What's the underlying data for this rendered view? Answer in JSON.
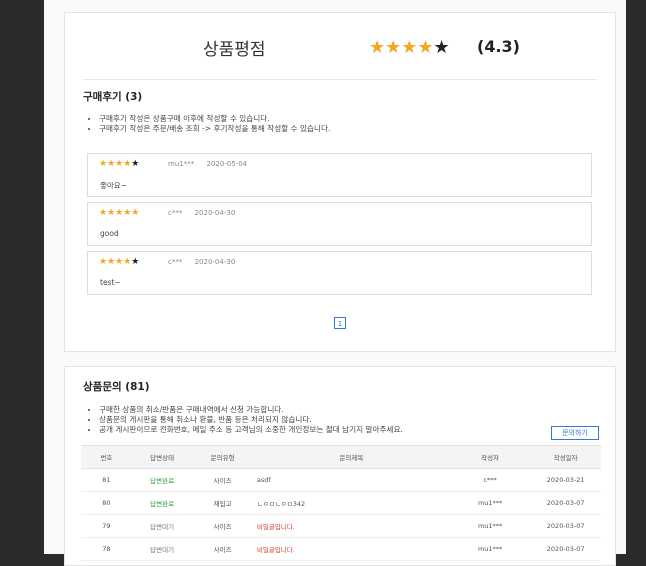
{
  "rating": {
    "title": "상품평점",
    "score_text": "(4.3)",
    "stars": "★★★★★"
  },
  "reviews_section": {
    "title": "구매후기",
    "count": "(3)",
    "notices": [
      "구매후기 작성은 상품구매 이후에 작성할 수 있습니다.",
      "구매후기 작성은 주문/배송 조회 -> 후기작성을 통해 작성할 수 있습니다."
    ],
    "items": [
      {
        "stars_on": "★★★★",
        "stars_off": "★",
        "user": "mu1***",
        "date": "2020-05-04",
        "text": "좋아요~"
      },
      {
        "stars_on": "★★★★★",
        "stars_off": "",
        "user": "c***",
        "date": "2020-04-30",
        "text": "good"
      },
      {
        "stars_on": "★★★★",
        "stars_off": "★",
        "user": "c***",
        "date": "2020-04-30",
        "text": "test~"
      }
    ],
    "pager": "1"
  },
  "qna_section": {
    "title": "상품문의",
    "count": "(81)",
    "notices": [
      "구매한 상품의 취소/반품은 구매내역에서 신청 가능합니다.",
      "상품문의 게시판을 통해 취소나 환불, 반품 등은 처리되지 않습니다.",
      "공개 게시판이므로 전화번호, 메일 주소 등 고객님의 소중한 개인정보는 절대 남기지 말아주세요."
    ],
    "ask_button": "문의하기",
    "columns": [
      "번호",
      "답변상태",
      "문의유형",
      "문의제목",
      "작성자",
      "작성일자"
    ],
    "rows": [
      {
        "no": "81",
        "status": "답변완료",
        "status_type": "done",
        "type": "사이즈",
        "title": "asdf",
        "title_type": "normal",
        "writer": "c***",
        "date": "2020-03-21"
      },
      {
        "no": "80",
        "status": "답변완료",
        "status_type": "done",
        "type": "재입고",
        "title": "ㄴㅇㅁㄴㅇㅁ342",
        "title_type": "normal",
        "writer": "mu1***",
        "date": "2020-03-07"
      },
      {
        "no": "79",
        "status": "답변대기",
        "status_type": "wait",
        "type": "사이즈",
        "title": "비밀글입니다.",
        "title_type": "secret",
        "writer": "mu1***",
        "date": "2020-03-07"
      },
      {
        "no": "78",
        "status": "답변대기",
        "status_type": "wait",
        "type": "사이즈",
        "title": "비밀글입니다.",
        "title_type": "secret",
        "writer": "mu1***",
        "date": "2020-03-07"
      }
    ]
  },
  "colors": {
    "star": "#f5a623",
    "link_blue": "#2f7bd6",
    "answered_green": "#2e9e3a",
    "secret_red": "#e53935"
  }
}
